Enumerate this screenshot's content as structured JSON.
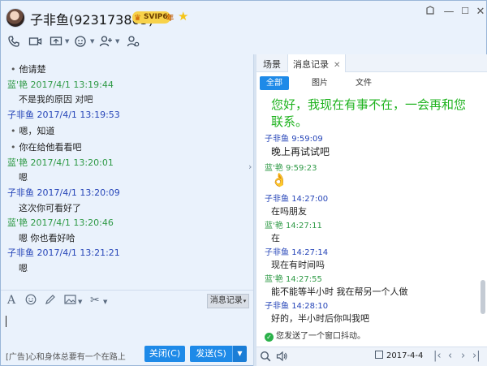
{
  "window": {
    "title": "子非鱼(923173805)",
    "svip_badge": "SVIP6",
    "svip_year": "年",
    "controls": {
      "skin": "skin-icon",
      "minimize": "—",
      "maximize": "☐",
      "close": "✕"
    }
  },
  "toolbar": {
    "icons": [
      "phone-icon",
      "video-icon",
      "share-screen-icon",
      "remote-assist-icon",
      "add-contact-icon",
      "app-icon"
    ]
  },
  "chat": {
    "messages": [
      {
        "type": "text",
        "text": "他请楚"
      },
      {
        "type": "header",
        "sender": "蓝'艳",
        "time": "2017/4/1 13:19:44",
        "color": "green"
      },
      {
        "type": "text",
        "text": "不是我的原因 对吧"
      },
      {
        "type": "header",
        "sender": "子非鱼",
        "time": "2017/4/1 13:19:53",
        "color": "blue"
      },
      {
        "type": "text",
        "text": "嗯，知道"
      },
      {
        "type": "text",
        "text": "你在给他看看吧"
      },
      {
        "type": "header",
        "sender": "蓝'艳",
        "time": "2017/4/1 13:20:01",
        "color": "green"
      },
      {
        "type": "text",
        "text": "嗯"
      },
      {
        "type": "header",
        "sender": "子非鱼",
        "time": "2017/4/1 13:20:09",
        "color": "blue"
      },
      {
        "type": "text",
        "text": "这次你可看好了"
      },
      {
        "type": "header",
        "sender": "蓝'艳",
        "time": "2017/4/1 13:20:46",
        "color": "green"
      },
      {
        "type": "text",
        "text": "嗯 你也看好哈"
      },
      {
        "type": "header",
        "sender": "子非鱼",
        "time": "2017/4/1 13:21:21",
        "color": "blue"
      },
      {
        "type": "text",
        "text": "嗯"
      }
    ]
  },
  "input": {
    "msglog_label": "消息记录",
    "ad_text": "[广告]心和身体总要有一个在路上",
    "close_label": "关闭(C)",
    "send_label": "发送(S)"
  },
  "history": {
    "tabs": [
      {
        "label": "场景"
      },
      {
        "label": "消息记录",
        "close": "✕"
      }
    ],
    "filters": [
      {
        "label": "全部"
      },
      {
        "label": "图片"
      },
      {
        "label": "文件"
      }
    ],
    "auto_reply": "您好，我现在有事不在，一会再和您联系。",
    "entries": [
      {
        "sender": "子非鱼",
        "time": "9:59:09",
        "color": "blue",
        "text": "晚上再试试吧"
      },
      {
        "sender": "蓝'艳",
        "time": "9:59:23",
        "color": "green",
        "text": ""
      },
      {
        "sender": "子非鱼",
        "time": "14:27:00",
        "color": "blue",
        "text": "在吗朋友"
      },
      {
        "sender": "蓝'艳",
        "time": "14:27:11",
        "color": "green",
        "text": "在"
      },
      {
        "sender": "子非鱼",
        "time": "14:27:14",
        "color": "blue",
        "text": "现在有时间吗"
      },
      {
        "sender": "蓝'艳",
        "time": "14:27:55",
        "color": "green",
        "text": "能不能等半小时 我在帮另一个人做"
      },
      {
        "sender": "子非鱼",
        "time": "14:28:10",
        "color": "blue",
        "text": "好的，半小时后你叫我吧"
      }
    ],
    "shake_text": "您发送了一个窗口抖动。",
    "date": "2017-4-4"
  }
}
